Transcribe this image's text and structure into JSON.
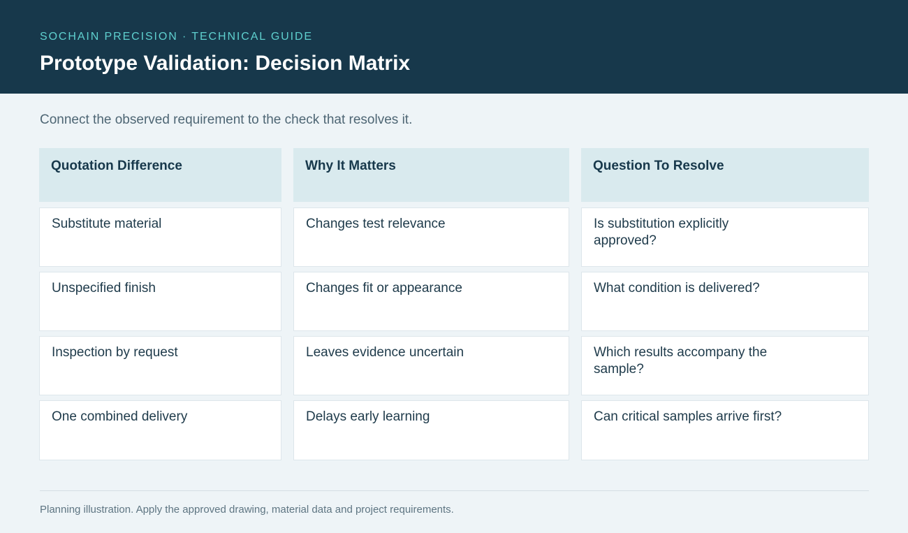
{
  "header": {
    "eyebrow": "SOCHAIN PRECISION · TECHNICAL GUIDE",
    "title": "Prototype Validation: Decision Matrix"
  },
  "intro": "Connect the observed requirement to the check that resolves it.",
  "table": {
    "columns": [
      "Quotation Difference",
      "Why It Matters",
      "Question To Resolve"
    ],
    "rows": [
      [
        "Substitute material",
        "Changes test relevance",
        "Is substitution explicitly approved?"
      ],
      [
        "Unspecified finish",
        "Changes fit or appearance",
        "What condition is delivered?"
      ],
      [
        "Inspection by request",
        "Leaves evidence uncertain",
        "Which results accompany the sample?"
      ],
      [
        "One combined delivery",
        "Delays early learning",
        "Can critical samples arrive first?"
      ]
    ]
  },
  "footnote": "Planning illustration. Apply the approved drawing, material data and project requirements.",
  "colors": {
    "header_bg": "#17384b",
    "accent": "#5fd0cf",
    "page_bg": "#eef4f7",
    "table_head_bg": "#d9eaee"
  }
}
